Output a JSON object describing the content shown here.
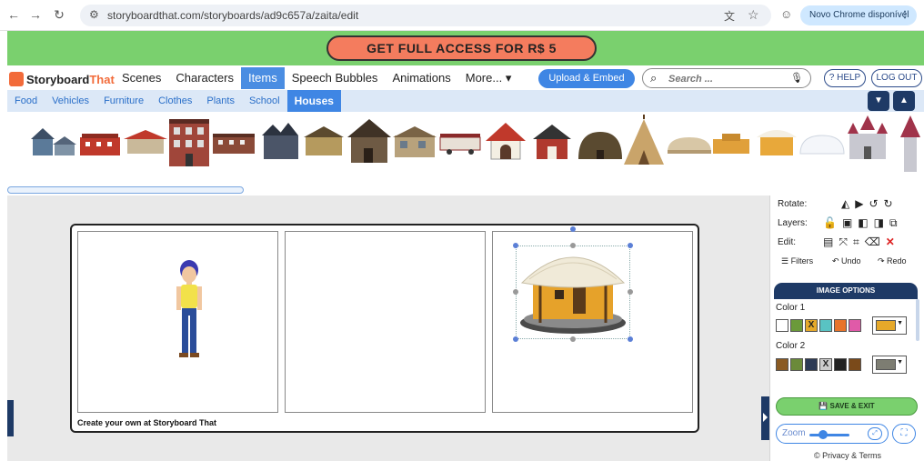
{
  "browser": {
    "back": "←",
    "forward": "→",
    "reload": "↻",
    "url": "storyboardthat.com/storyboards/ad9c657a/zaita/edit",
    "update_label": "Novo Chrome disponível"
  },
  "promo": {
    "label": "GET FULL ACCESS FOR R$ 5"
  },
  "logo": {
    "part1": "Storyboard",
    "part2": "That"
  },
  "nav": {
    "items": [
      {
        "label": "Scenes"
      },
      {
        "label": "Characters"
      },
      {
        "label": "Items"
      },
      {
        "label": "Speech Bubbles"
      },
      {
        "label": "Animations"
      },
      {
        "label": "More... ▾"
      }
    ],
    "active_index": 2,
    "upload_label": "Upload & Embed",
    "search_placeholder": "Search ...",
    "help_label": "? HELP",
    "logout_label": "LOG OUT"
  },
  "subnav": {
    "items": [
      {
        "label": "Food"
      },
      {
        "label": "Vehicles"
      },
      {
        "label": "Furniture"
      },
      {
        "label": "Clothes"
      },
      {
        "label": "Plants"
      },
      {
        "label": "School"
      },
      {
        "label": "Houses"
      }
    ],
    "active_index": 6
  },
  "storyboard": {
    "credit": "Create your own at Storyboard That"
  },
  "panel": {
    "rotate_label": "Rotate:",
    "layers_label": "Layers:",
    "edit_label": "Edit:",
    "filters_label": "Filters",
    "undo_label": "Undo",
    "redo_label": "Redo",
    "image_options_label": "IMAGE OPTIONS",
    "color1_label": "Color 1",
    "color2_label": "Color 2",
    "color1_swatches": [
      "#ffffff",
      "#6b9a3a",
      "#e6a92a",
      "#59c3c3",
      "#e8742a",
      "#e05aa8"
    ],
    "color1_selected": "#e6a92a",
    "color2_swatches": [
      "#8a5a22",
      "#6b8a3a",
      "#2c3a55",
      "#cccccc",
      "#222222",
      "#7a4a1a"
    ],
    "color2_selected": "#7d7d72",
    "save_label": "SAVE & EXIT",
    "zoom_label": "Zoom",
    "privacy_label": "© Privacy & Terms"
  }
}
